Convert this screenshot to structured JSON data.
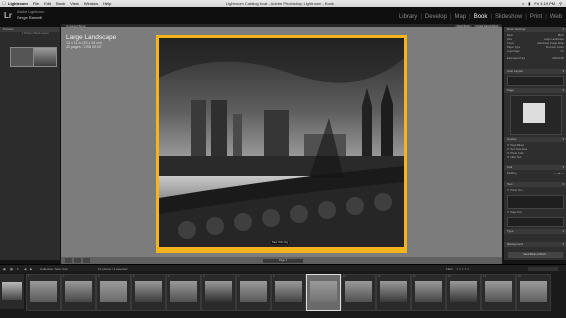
{
  "menubar": {
    "app_name": "Lightroom",
    "items": [
      "File",
      "Edit",
      "Book",
      "View",
      "Window",
      "Help"
    ],
    "window_title": "Lightroom Catalog.lrcat - Adobe Photoshop Lightroom - Book",
    "clock": "Fri 1:19 PM"
  },
  "identity": {
    "logo": "Lr",
    "line1": "Adobe Lightroom",
    "line2": "Serge Ramelli"
  },
  "modules": [
    "Library",
    "Develop",
    "Map",
    "Book",
    "Slideshow",
    "Print",
    "Web"
  ],
  "active_module": "Book",
  "left_panel": {
    "preview_header": "Preview",
    "preview_subtitle": "1 Photo in Book Layout"
  },
  "center": {
    "header_left": "Unsaved Book",
    "header_buttons": [
      "Clear Book",
      "Create Saved Book"
    ],
    "page_title": "Large Landscape",
    "page_size": "13 x 11 in (33 x 28 cm)",
    "page_count": "40 pages - US$ 00.00",
    "caption": "New York City",
    "page_label": "Page 1"
  },
  "right_panel": {
    "book_settings_header": "Book Settings",
    "settings_rows": [
      {
        "label": "Book",
        "value": "Blurb"
      },
      {
        "label": "Size",
        "value": "Large Landscape"
      },
      {
        "label": "Cover",
        "value": "Hardcover Image Wrap"
      },
      {
        "label": "Paper Type",
        "value": "Premium Lustre"
      },
      {
        "label": "Logo Page",
        "value": "On"
      },
      {
        "label": "Estimated Price",
        "value": "US$ 00.00"
      }
    ],
    "auto_layout_header": "Auto Layout",
    "page_header": "Page",
    "guides_header": "Guides",
    "guides": [
      "Page Bleed",
      "Text Safe Area",
      "Photo Cells",
      "Filler Text"
    ],
    "cell_header": "Cell",
    "padding_label": "Padding",
    "text_header": "Text",
    "photo_text_label": "Photo Text",
    "page_text_label": "Page Text",
    "type_header": "Type",
    "background_header": "Background",
    "send_button": "Send Book to Blurb..."
  },
  "toolbar": {
    "page_indicator": "1",
    "source": "Collection: New York",
    "photo_count": "14 photos / 1 selected",
    "filter_label": "Filter:"
  },
  "filmstrip": {
    "thumbnails": [
      {
        "num": "1",
        "tone": "#5a5a5a"
      },
      {
        "num": "2",
        "tone": "#474747"
      },
      {
        "num": "3",
        "tone": "#6b6b6b"
      },
      {
        "num": "4",
        "tone": "#3d3d3d"
      },
      {
        "num": "5",
        "tone": "#505050"
      },
      {
        "num": "6",
        "tone": "#2f2f2f"
      },
      {
        "num": "7",
        "tone": "#585858"
      },
      {
        "num": "8",
        "tone": "#444444"
      },
      {
        "num": "9",
        "tone": "#737373"
      },
      {
        "num": "10",
        "tone": "#505050"
      },
      {
        "num": "11",
        "tone": "#3a3a3a"
      },
      {
        "num": "12",
        "tone": "#464646"
      },
      {
        "num": "13",
        "tone": "#363636"
      },
      {
        "num": "14",
        "tone": "#525252"
      },
      {
        "num": "15",
        "tone": "#606060"
      },
      {
        "num": "16",
        "tone": "#4a4a4a"
      }
    ],
    "selected_index": 8
  },
  "colors": {
    "accent_page": "#f3b41c",
    "active_module": "#f2f2f2"
  }
}
